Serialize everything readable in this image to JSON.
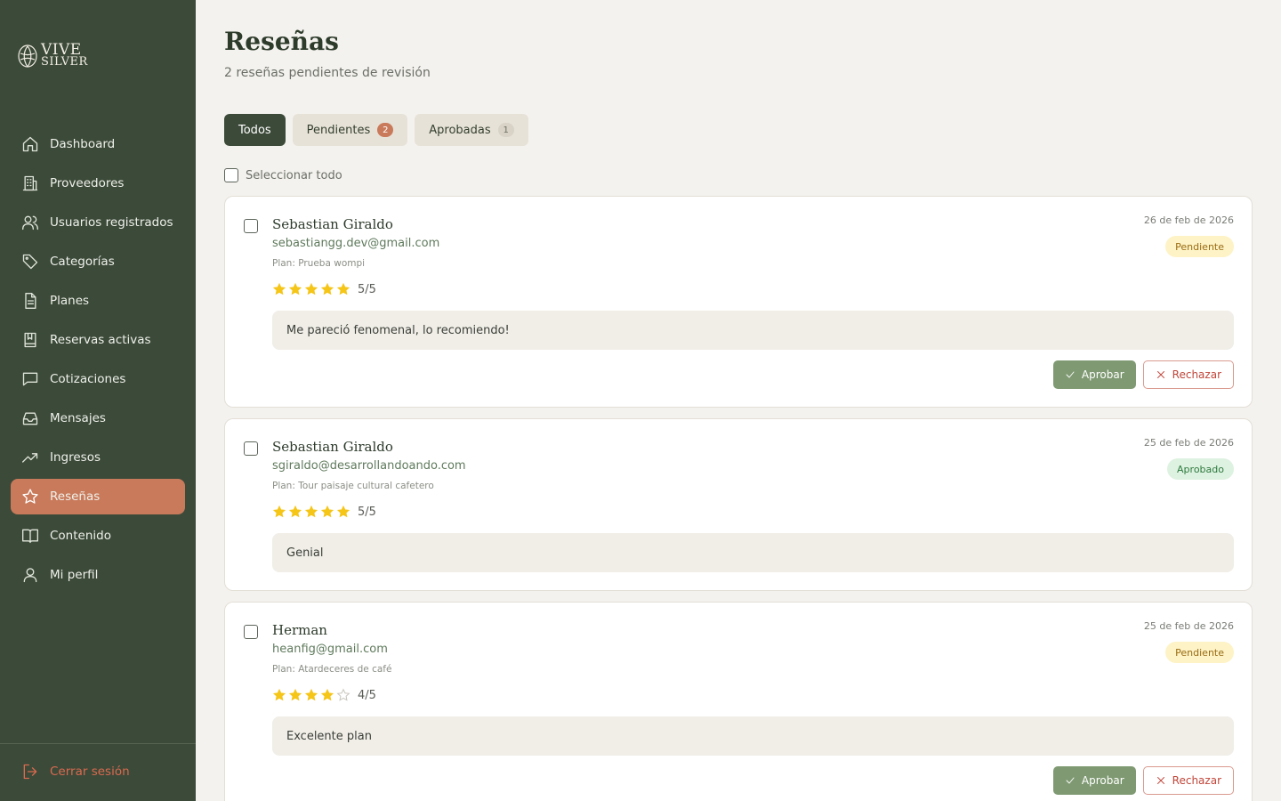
{
  "brand": {
    "line1": "VIVE",
    "line2": "SILVER"
  },
  "sidebar": {
    "items": [
      {
        "label": "Dashboard",
        "icon": "home-icon"
      },
      {
        "label": "Proveedores",
        "icon": "building-icon"
      },
      {
        "label": "Usuarios registrados",
        "icon": "users-icon"
      },
      {
        "label": "Categorías",
        "icon": "tag-icon"
      },
      {
        "label": "Planes",
        "icon": "document-icon"
      },
      {
        "label": "Reservas activas",
        "icon": "bookmark-book-icon"
      },
      {
        "label": "Cotizaciones",
        "icon": "chat-icon"
      },
      {
        "label": "Mensajes",
        "icon": "inbox-icon"
      },
      {
        "label": "Ingresos",
        "icon": "trending-up-icon"
      },
      {
        "label": "Reseñas",
        "icon": "star-icon",
        "active": true
      },
      {
        "label": "Contenido",
        "icon": "open-book-icon"
      },
      {
        "label": "Mi perfil",
        "icon": "user-icon"
      }
    ],
    "logout_label": "Cerrar sesión"
  },
  "header": {
    "title": "Reseñas",
    "subtitle": "2 reseñas pendientes de revisión"
  },
  "tabs": [
    {
      "label": "Todos",
      "active": true
    },
    {
      "label": "Pendientes",
      "count": "2"
    },
    {
      "label": "Aprobadas",
      "count": "1"
    }
  ],
  "select_all_label": "Seleccionar todo",
  "colors": {
    "sidebar_bg": "#3c4a39",
    "accent": "#c97a5b",
    "star": "#f5c518",
    "approve": "#7f9a72",
    "reject": "#c0463a"
  },
  "reviews": [
    {
      "name": "Sebastian Giraldo",
      "email": "sebastiangg.dev@gmail.com",
      "plan": "Plan: Prueba wompi",
      "date": "26 de feb de 2026",
      "status": "Pendiente",
      "rating": 5,
      "score": "5/5",
      "comment": "Me pareció fenomenal, lo recomiendo!"
    },
    {
      "name": "Sebastian Giraldo",
      "email": "sgiraldo@desarrollandoando.com",
      "plan": "Plan: Tour paisaje cultural cafetero",
      "date": "25 de feb de 2026",
      "status": "Aprobado",
      "rating": 5,
      "score": "5/5",
      "comment": "Genial"
    },
    {
      "name": "Herman",
      "email": "heanfig@gmail.com",
      "plan": "Plan: Atardeceres de café",
      "date": "25 de feb de 2026",
      "status": "Pendiente",
      "rating": 4,
      "score": "4/5",
      "comment": "Excelente plan"
    }
  ],
  "actions": {
    "approve_label": "Aprobar",
    "reject_label": "Rechazar"
  }
}
